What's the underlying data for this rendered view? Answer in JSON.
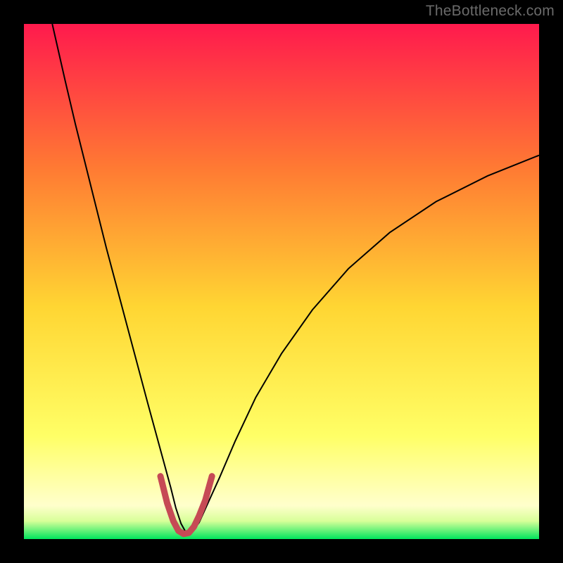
{
  "watermark": "TheBottleneck.com",
  "chart_data": {
    "type": "line",
    "title": "",
    "xlabel": "",
    "ylabel": "",
    "xlim": [
      0,
      100
    ],
    "ylim": [
      0,
      100
    ],
    "background_gradient": {
      "top": "#ff1a4d",
      "mid_upper": "#ff7a33",
      "mid": "#ffd633",
      "mid_lower": "#ffff66",
      "low_band": "#ffffcc",
      "bottom": "#00e65c"
    },
    "series": [
      {
        "name": "bottleneck-curve",
        "stroke": "#000000",
        "stroke_width": 2,
        "x": [
          5.5,
          8,
          10,
          12,
          14,
          16,
          18,
          20,
          22,
          24,
          25.5,
          27,
          28.5,
          29.5,
          30.5,
          31.5,
          32.5,
          34,
          35.5,
          38,
          41,
          45,
          50,
          56,
          63,
          71,
          80,
          90,
          100
        ],
        "y": [
          100,
          89,
          80.5,
          72.5,
          64.5,
          56.5,
          49,
          41.5,
          34,
          26.5,
          21,
          15.5,
          10,
          6,
          3,
          1.2,
          1.2,
          3.2,
          6.5,
          12,
          19,
          27.5,
          36,
          44.5,
          52.5,
          59.5,
          65.5,
          70.5,
          74.5
        ]
      },
      {
        "name": "valley-highlight",
        "stroke": "#c64a55",
        "stroke_width": 9,
        "linecap": "round",
        "x": [
          26.5,
          27.8,
          29,
          30,
          31,
          32,
          33,
          34,
          35.2,
          36.5
        ],
        "y": [
          12.2,
          7,
          3.5,
          1.6,
          1.0,
          1.2,
          2.4,
          4.5,
          7.5,
          12.2
        ]
      }
    ]
  }
}
